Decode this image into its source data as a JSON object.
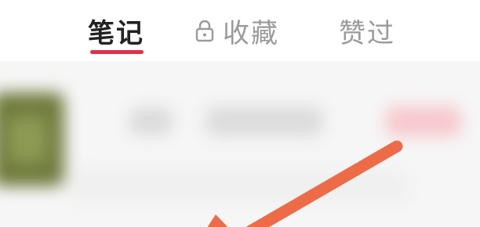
{
  "tabs": {
    "notes": "笔记",
    "favorites": "收藏",
    "liked": "赞过",
    "active": "notes",
    "favorites_icon": "lock-icon"
  },
  "colors": {
    "active_underline": "#e0314b",
    "annotation_arrow": "#ee6b47"
  }
}
